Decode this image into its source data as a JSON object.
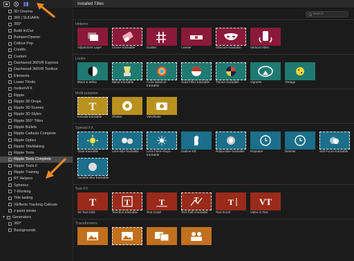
{
  "sidebar": {
    "toolbar": [
      "film-icon",
      "gear-icon",
      "titles-icon"
    ],
    "items": [
      {
        "label": "3D Cinema",
        "sel": false
      },
      {
        "label": "360 | SUGARfx",
        "sel": false
      },
      {
        "label": "360°",
        "sel": false
      },
      {
        "label": "Build In/Out",
        "sel": false
      },
      {
        "label": "Bumper/Opener",
        "sel": false
      },
      {
        "label": "Callout Pop",
        "sel": false
      },
      {
        "label": "Credits",
        "sel": false
      },
      {
        "label": "Custom",
        "sel": false
      },
      {
        "label": "Dashwood 360VR Express",
        "sel": false
      },
      {
        "label": "Dashwood 360VR Toolbox",
        "sel": false
      },
      {
        "label": "Elements",
        "sel": false
      },
      {
        "label": "Lower Thirds",
        "sel": false
      },
      {
        "label": "motionVFX",
        "sel": false
      },
      {
        "label": "Ripple",
        "sel": false
      },
      {
        "label": "Ripple 3D Drops",
        "sel": false
      },
      {
        "label": "Ripple 3D Scenes",
        "sel": false
      },
      {
        "label": "Ripple 3D Styles",
        "sel": false
      },
      {
        "label": "Ripple 360° Titles",
        "sel": false
      },
      {
        "label": "Ripple Bullets",
        "sel": false
      },
      {
        "label": "Ripple Callouts Complete",
        "sel": false
      },
      {
        "label": "Ripple Optics",
        "sel": false
      },
      {
        "label": "Ripple TitleMaking",
        "sel": false
      },
      {
        "label": "Ripple Tools",
        "sel": false
      },
      {
        "label": "Ripple Tools Complete",
        "sel": true
      },
      {
        "label": "Ripple Tools II",
        "sel": false
      },
      {
        "label": "Ripple Training",
        "sel": false
      },
      {
        "label": "RT Helpers",
        "sel": false
      },
      {
        "label": "Spherico",
        "sel": false
      },
      {
        "label": "T-Working",
        "sel": false
      },
      {
        "label": "Title tasting",
        "sel": false
      },
      {
        "label": "XEffects Tracking Callouts",
        "sel": false
      },
      {
        "label": "z-paint stroke",
        "sel": false
      }
    ],
    "group": {
      "label": "Generators"
    },
    "subitems": [
      {
        "label": "360°"
      },
      {
        "label": "Backgrounds"
      }
    ]
  },
  "main": {
    "title": "Installed Titles",
    "search_placeholder": "Search",
    "sections": [
      {
        "title": "Helpers",
        "tiles": [
          {
            "label": "Adjustment Layer",
            "color": "#8b1a3a",
            "icon": "adjust-icon",
            "dash": false
          },
          {
            "label": "Cloner-trackable",
            "color": "#8b1a3a",
            "icon": "eraser-icon",
            "dash": true
          },
          {
            "label": "Guides",
            "color": "#8b1a3a",
            "icon": "grid-icon",
            "dash": false
          },
          {
            "label": "Leveler",
            "color": "#8b1a3a",
            "icon": "level-icon",
            "dash": false
          },
          {
            "label": "Obscure-trackable",
            "color": "#8b1a3a",
            "icon": "mask-icon",
            "dash": true
          },
          {
            "label": "Vertical Video",
            "color": "#8b1a3a",
            "icon": "phone-icon",
            "dash": false
          }
        ]
      },
      {
        "title": "Looks",
        "tiles": [
          {
            "label": "Black & White",
            "color": "#1f7a72",
            "icon": "bw-icon",
            "dash": false
          },
          {
            "label": "Blend-trackable",
            "color": "#1f7a72",
            "icon": "blender-icon",
            "dash": true
          },
          {
            "label": "Color Balance-trackable",
            "color": "#1f7a72",
            "icon": "colorwheel-icon",
            "dash": true
          },
          {
            "label": "Grad Filter-trackable",
            "color": "#1f7a72",
            "icon": "grad-icon",
            "dash": true
          },
          {
            "label": "Tritone-trackable",
            "color": "#1f7a72",
            "icon": "tritone-icon",
            "dash": true
          },
          {
            "label": "Vignette",
            "color": "#1f7a72",
            "icon": "vignette-icon",
            "dash": false
          },
          {
            "label": "Vintage",
            "color": "#1f7a72",
            "icon": "vintage-icon",
            "dash": false
          }
        ]
      },
      {
        "title": "Multi-purpose",
        "tiles": [
          {
            "label": "Extrude-trackable",
            "color": "#b8911e",
            "icon": "extrude-icon",
            "dash": true
          },
          {
            "label": "Shutter",
            "color": "#b8911e",
            "icon": "shutter-icon",
            "dash": false
          },
          {
            "label": "Viewfinder",
            "color": "#b8911e",
            "icon": "camera-icon",
            "dash": false
          }
        ]
      },
      {
        "title": "Special FX",
        "tiles": [
          {
            "label": "Glow-trackable",
            "color": "#1b6f8a",
            "icon": "glow-icon",
            "dash": true
          },
          {
            "label": "Lens Blur-trackable",
            "color": "#1b6f8a",
            "icon": "lensblur-icon",
            "dash": true
          },
          {
            "label": "Lens Flare+Rays-trackable",
            "color": "#1b6f8a",
            "icon": "flare-icon",
            "dash": true
          },
          {
            "label": "Outline-Fill",
            "color": "#1b6f8a",
            "icon": "outline-icon",
            "dash": false
          },
          {
            "label": "Radial Blur-trackable",
            "color": "#1b6f8a",
            "icon": "radial-icon",
            "dash": true
          },
          {
            "label": "Repeater",
            "color": "#1b6f8a",
            "icon": "clock-icon",
            "dash": false
          },
          {
            "label": "Retimer",
            "color": "#1b6f8a",
            "icon": "clock-icon",
            "dash": false
          },
          {
            "label": "Soft Focus-trackable",
            "color": "#1b6f8a",
            "icon": "softfocus-icon",
            "dash": true
          },
          {
            "label": "Variable Blur-trackable",
            "color": "#1b6f8a",
            "icon": "varblur-icon",
            "dash": true
          }
        ]
      },
      {
        "title": "Text FX",
        "tiles": [
          {
            "label": "3D Text Glint",
            "color": "#9a2a1a",
            "icon": "text-icon",
            "dash": false
          },
          {
            "label": "Text Box-trackable",
            "color": "#9a2a1a",
            "icon": "textbox-icon",
            "dash": true
          },
          {
            "label": "Text Crawl",
            "color": "#9a2a1a",
            "icon": "textcrawl-icon",
            "dash": false
          },
          {
            "label": "Text Path-trackable",
            "color": "#9a2a1a",
            "icon": "textpath-icon",
            "dash": true
          },
          {
            "label": "Text Scroll",
            "color": "#9a2a1a",
            "icon": "textscroll-icon",
            "dash": false
          },
          {
            "label": "Video in Text",
            "color": "#9a2a1a",
            "icon": "videotext-icon",
            "dash": false
          }
        ]
      },
      {
        "title": "Transformers",
        "tiles": [
          {
            "label": "",
            "color": "#c2701e",
            "icon": "image-icon",
            "dash": false
          },
          {
            "label": "",
            "color": "#c2701e",
            "icon": "image-icon",
            "dash": true
          },
          {
            "label": "",
            "color": "#c2701e",
            "icon": "images-icon",
            "dash": false
          },
          {
            "label": "",
            "color": "#c2701e",
            "icon": "people-icon",
            "dash": false
          }
        ]
      }
    ]
  },
  "accent": "#f08a24"
}
